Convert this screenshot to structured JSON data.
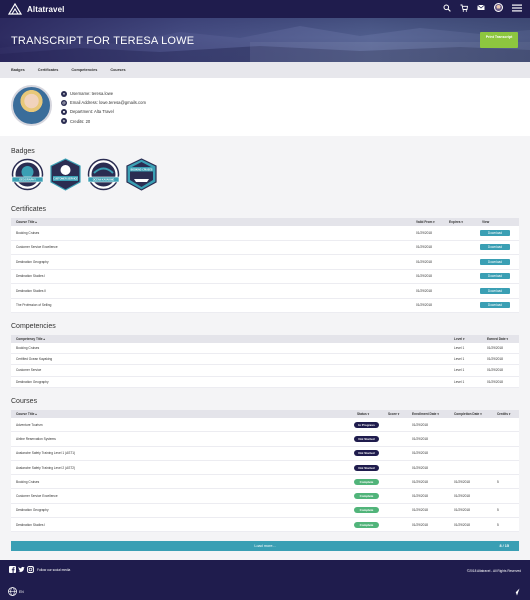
{
  "app": {
    "brand": "Altatravel"
  },
  "hero": {
    "title": "TRANSCRIPT FOR TERESA LOWE",
    "print_label": "Print Transcript"
  },
  "tabs": [
    "Badges",
    "Certificates",
    "Competencies",
    "Courses"
  ],
  "profile": {
    "username": "Username: teresa.lowe",
    "email": "Email Address: lowe.teresa@gmails.com",
    "department": "Department: Alta Travel",
    "credits": "Credits: 20"
  },
  "sections": {
    "badges": "Badges",
    "certificates": "Certificates",
    "competencies": "Competencies",
    "courses": "Courses"
  },
  "badges": [
    {
      "label": "GEOGRAPHY",
      "color": "#3a9fb4"
    },
    {
      "label": "CUSTOMER SERVICE",
      "color": "#3a9fb4"
    },
    {
      "label": "OCEAN KAYAKING",
      "color": "#3a9fb4"
    },
    {
      "label": "BOOKING CRUISES",
      "color": "#2b2d52"
    }
  ],
  "certificates": {
    "headers": {
      "title": "Course Title ▴",
      "valid_from": "Valid From ▾",
      "expires": "Expires ▾",
      "view": "View"
    },
    "download_label": "Download",
    "rows": [
      {
        "title": "Booking Cruises",
        "valid_from": "01/29/2018"
      },
      {
        "title": "Customer Service Excellence",
        "valid_from": "01/29/2018"
      },
      {
        "title": "Destination Geography",
        "valid_from": "01/29/2018"
      },
      {
        "title": "Destination Studies I",
        "valid_from": "01/29/2018"
      },
      {
        "title": "Destination Studies II",
        "valid_from": "01/29/2018"
      },
      {
        "title": "The Profession of Selling",
        "valid_from": "01/29/2018"
      }
    ]
  },
  "competencies": {
    "headers": {
      "title": "Competency Title ▴",
      "level": "Level ▾",
      "earned": "Earned Date ▾"
    },
    "rows": [
      {
        "title": "Booking Cruises",
        "level": "Level 1",
        "earned": "01/29/2018"
      },
      {
        "title": "Certified Ocean Kayaking",
        "level": "Level 1",
        "earned": "01/29/2018"
      },
      {
        "title": "Customer Service",
        "level": "Level 1",
        "earned": "01/29/2018"
      },
      {
        "title": "Destination Geography",
        "level": "Level 1",
        "earned": "01/29/2018"
      }
    ]
  },
  "courses": {
    "headers": {
      "title": "Course Title ▴",
      "status": "Status ▾",
      "score": "Score ▾",
      "enrollment": "Enrollment Date ▾",
      "completion": "Completion Date ▾",
      "credits": "Credits ▾"
    },
    "rows": [
      {
        "title": "Adventure Tourism",
        "status": "In Progress",
        "style": "navy",
        "enrollment": "01/29/2018",
        "completion": "",
        "credits": ""
      },
      {
        "title": "Airline Reservation Systems",
        "status": "Not Started",
        "style": "navy",
        "enrollment": "01/29/2018",
        "completion": "",
        "credits": ""
      },
      {
        "title": "Avalanche Safety Training Level 1 (AST1)",
        "status": "Not Started",
        "style": "navy",
        "enrollment": "01/29/2018",
        "completion": "",
        "credits": ""
      },
      {
        "title": "Avalanche Safety Training Level 2 (AST2)",
        "status": "Not Started",
        "style": "navy",
        "enrollment": "01/29/2018",
        "completion": "",
        "credits": ""
      },
      {
        "title": "Booking Cruises",
        "status": "Complete",
        "style": "green",
        "enrollment": "01/29/2018",
        "completion": "01/29/2018",
        "credits": "5"
      },
      {
        "title": "Customer Service Excellence",
        "status": "Complete",
        "style": "green",
        "enrollment": "01/29/2018",
        "completion": "01/29/2018",
        "credits": ""
      },
      {
        "title": "Destination Geography",
        "status": "Complete",
        "style": "green",
        "enrollment": "01/29/2018",
        "completion": "01/29/2018",
        "credits": "5"
      },
      {
        "title": "Destination Studies I",
        "status": "Complete",
        "style": "green",
        "enrollment": "01/29/2018",
        "completion": "01/29/2018",
        "credits": "5"
      }
    ],
    "load_more": "Load more...",
    "count": "8 / 15"
  },
  "footer": {
    "follow": "Follow our social media",
    "copyright": "©2018 Altatravel - All Rights Reserved",
    "language": "EN"
  },
  "colors": {
    "navy": "#1f1c4d",
    "teal": "#3a9fb4",
    "green": "#51b47a",
    "print_green": "#8dc63f"
  }
}
